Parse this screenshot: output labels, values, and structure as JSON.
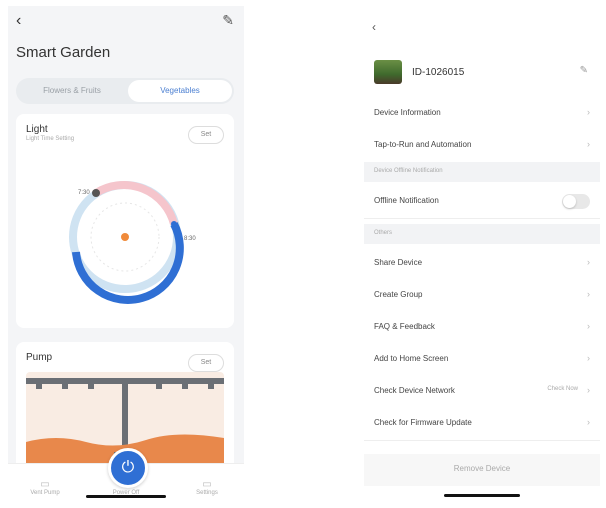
{
  "left": {
    "header": {
      "back_glyph": "‹",
      "edit_glyph": "✎",
      "title": "Smart Garden"
    },
    "tabs": [
      {
        "label": "Flowers & Fruits"
      },
      {
        "label": "Vegetables"
      }
    ],
    "light_card": {
      "title": "Light",
      "subtitle": "Light Time Setting",
      "button": "Set",
      "dial_labels": {
        "start": "7:30",
        "end": "8:30"
      },
      "colors": {
        "on": "#2f6fd4",
        "off": "#f5c5cc",
        "rest": "#cfe3f2"
      }
    },
    "pump_card": {
      "title": "Pump",
      "button": "Set"
    },
    "bottom_nav": [
      {
        "label": "Vent Pump",
        "icon": "pump-icon"
      },
      {
        "label": "Power Off",
        "icon": "power-icon"
      },
      {
        "label": "Settings",
        "icon": "settings-icon"
      }
    ]
  },
  "right": {
    "back_glyph": "‹",
    "device": {
      "name": "ID-1026015",
      "edit_glyph": "✎"
    },
    "rows_top": [
      {
        "label": "Device Information"
      },
      {
        "label": "Tap-to-Run and Automation"
      }
    ],
    "section_offline": "Device Offline Notification",
    "offline_row": {
      "label": "Offline Notification"
    },
    "section_others": "Others",
    "rows_others": [
      {
        "label": "Share Device"
      },
      {
        "label": "Create Group"
      },
      {
        "label": "FAQ & Feedback"
      },
      {
        "label": "Add to Home Screen"
      },
      {
        "label": "Check Device Network",
        "status": "Check Now"
      },
      {
        "label": "Check for Firmware Update"
      }
    ],
    "remove_label": "Remove Device"
  }
}
